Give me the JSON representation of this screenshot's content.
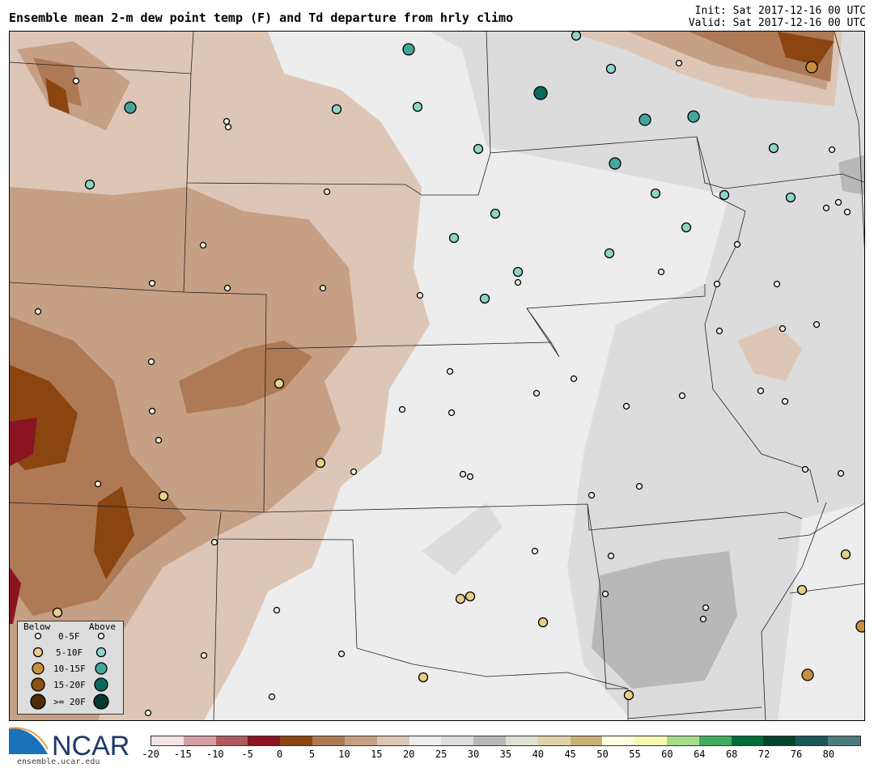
{
  "title": "Ensemble mean 2-m dew point temp (F) and Td departure from hrly climo",
  "init": "Init: Sat 2017-12-16 00 UTC",
  "valid": "Valid: Sat 2017-12-16 00 UTC",
  "logo": {
    "text": "NCAR",
    "url": "ensemble.ucar.edu"
  },
  "legend": {
    "below": "Below",
    "above": "Above",
    "rows": [
      "0-5F",
      "5-10F",
      "10-15F",
      "15-20F",
      ">= 20F"
    ],
    "below_colors": [
      "#f5f0dc",
      "#e8d08a",
      "#c88f3a",
      "#8b5210",
      "#4e2c08"
    ],
    "above_colors": [
      "#e8f5f2",
      "#8ed4c8",
      "#46a59a",
      "#0b6b60",
      "#033a30"
    ]
  },
  "colorbar": {
    "ticks": [
      "-20",
      "-15",
      "-10",
      "-5",
      "0",
      "5",
      "10",
      "15",
      "20",
      "25",
      "30",
      "35",
      "40",
      "45",
      "50",
      "55",
      "60",
      "64",
      "68",
      "72",
      "76",
      "80"
    ],
    "colors": [
      "#f2e4e4",
      "#d4a0a4",
      "#ae5a5e",
      "#8a1420",
      "#8a4510",
      "#ad7a55",
      "#c6a085",
      "#dec6b6",
      "#ededed",
      "#dcdcdc",
      "#b8b8b8",
      "#e0e0d2",
      "#e0d2aa",
      "#c8b276",
      "#ffffe4",
      "#f4f8b0",
      "#a8dc8c",
      "#40aa5e",
      "#006e3a",
      "#00442c",
      "#1a5658",
      "#4e7c7c"
    ]
  },
  "station_categories": [
    "a2",
    "a1",
    "a1",
    "b0",
    "b2",
    "b0",
    "a2",
    "a1",
    "a1",
    "a3",
    "a2",
    "a2",
    "b0",
    "b0",
    "a1",
    "a2",
    "a1",
    "b0",
    "a1",
    "b0",
    "a1",
    "a1",
    "a1",
    "b0",
    "b0",
    "b0",
    "a1",
    "a1",
    "a1",
    "b0",
    "b0",
    "a1",
    "a1",
    "b0",
    "b0",
    "b0",
    "b0",
    "b0",
    "b0",
    "a1",
    "b0",
    "b0",
    "b0",
    "b0",
    "b0",
    "b0",
    "b0",
    "b0",
    "b0",
    "b1",
    "b0",
    "b0",
    "b0",
    "b0",
    "b0",
    "b0",
    "b0",
    "b0",
    "b0",
    "b1",
    "b0",
    "b0",
    "b0",
    "b0",
    "b1",
    "b0",
    "b0",
    "b0",
    "b0",
    "b0",
    "b0",
    "b0",
    "b1",
    "b1",
    "b1",
    "b0",
    "b1",
    "b0",
    "b1",
    "b0",
    "b0",
    "b1",
    "b2",
    "b0",
    "b0",
    "b1",
    "b2",
    "b1",
    "b0",
    "b0"
  ]
}
